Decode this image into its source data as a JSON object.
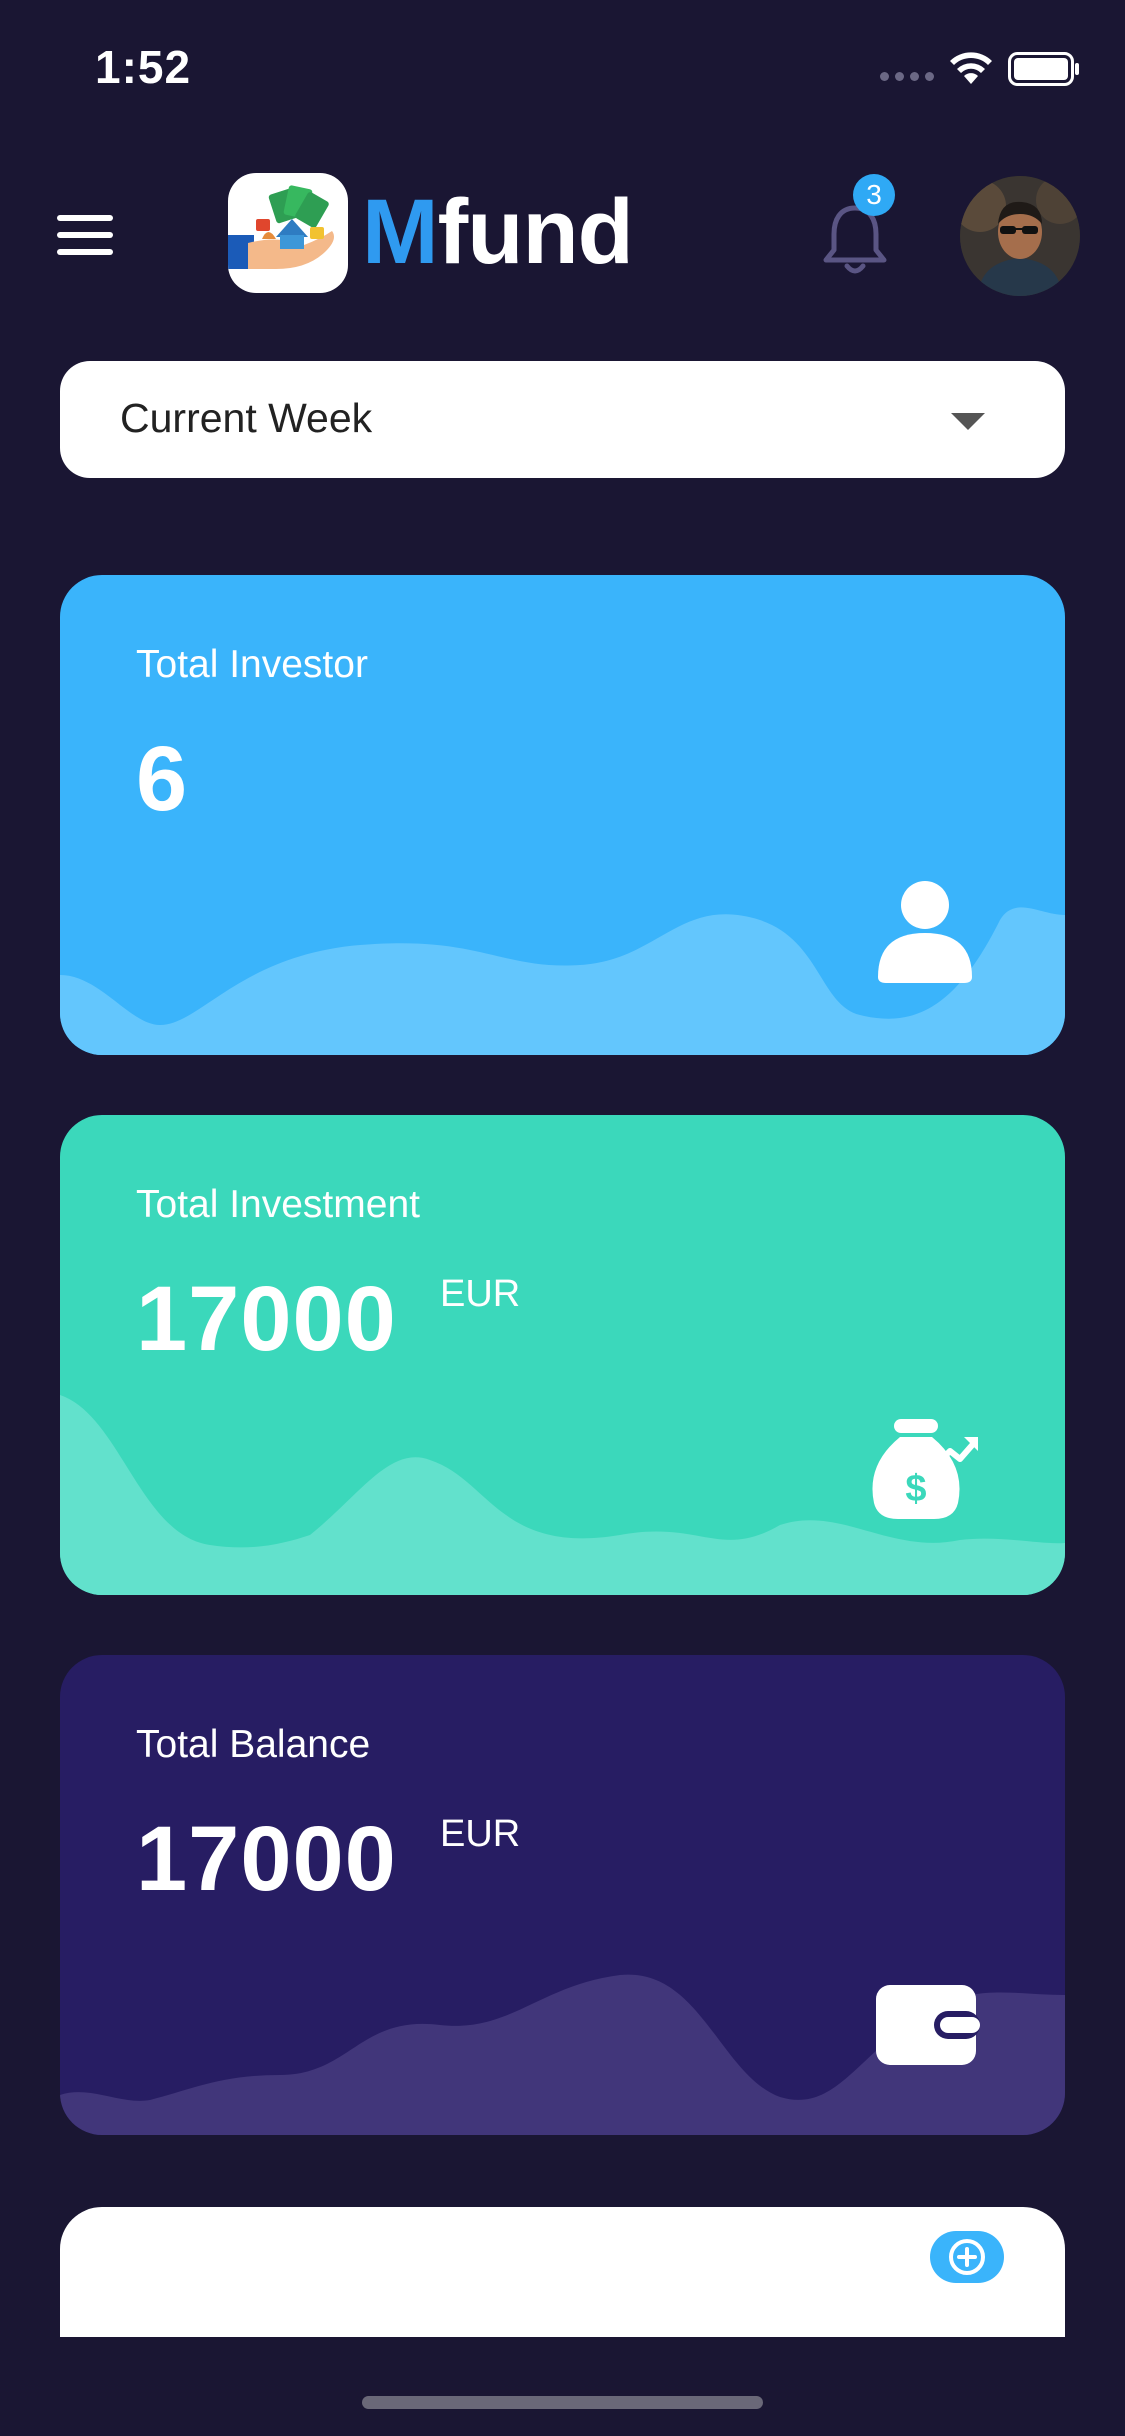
{
  "status_bar": {
    "time": "1:52"
  },
  "header": {
    "brand_first": "M",
    "brand_rest": "fund",
    "notification_count": "3"
  },
  "filter": {
    "selected": "Current Week"
  },
  "cards": {
    "investor": {
      "title": "Total Investor",
      "value": "6",
      "color": "#3ab4fb",
      "icon": "person-icon"
    },
    "investment": {
      "title": "Total Investment",
      "value": "17000",
      "unit": "EUR",
      "color": "#3bd8bb",
      "icon": "money-bag-icon"
    },
    "balance": {
      "title": "Total Balance",
      "value": "17000",
      "unit": "EUR",
      "color": "#271d63",
      "icon": "wallet-icon"
    }
  },
  "colors": {
    "background": "#1a1633",
    "brand_accent": "#2f9af0",
    "badge": "#2fa9f5"
  }
}
